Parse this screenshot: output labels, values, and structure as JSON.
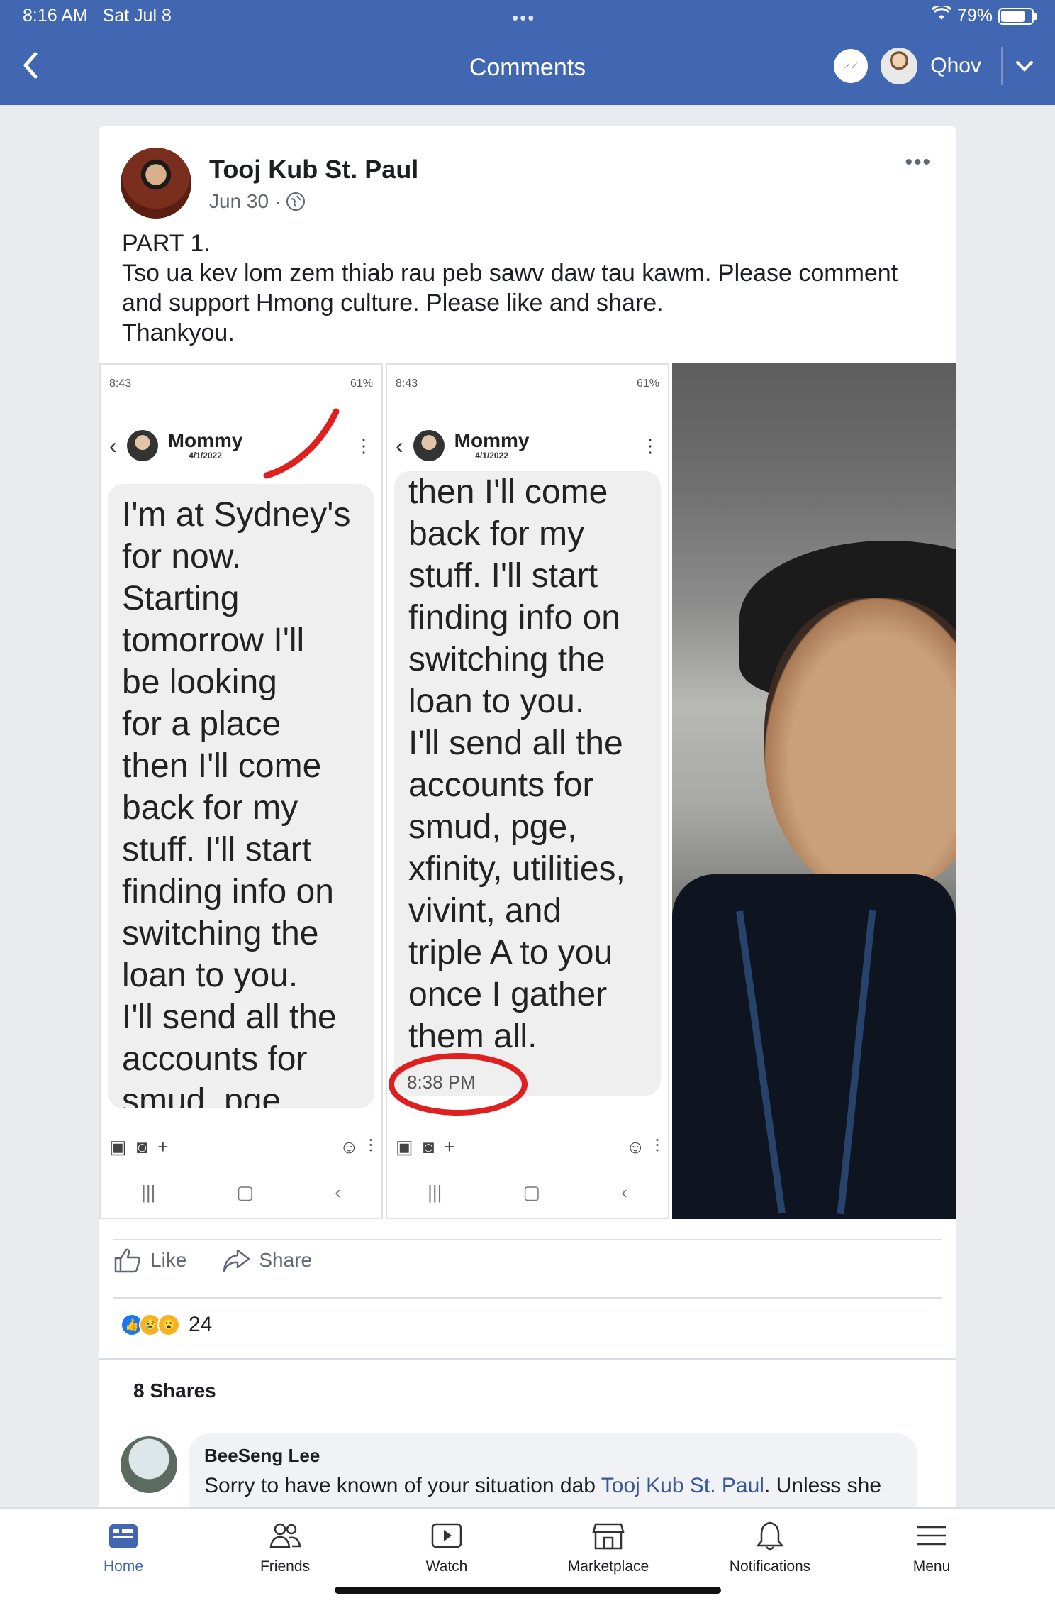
{
  "status_bar": {
    "time": "8:16 AM",
    "date": "Sat Jul 8",
    "battery": "79%",
    "battery_level": 0.79
  },
  "nav": {
    "title": "Comments",
    "user": "Qhov"
  },
  "post": {
    "author": "Tooj Kub St. Paul",
    "date": "Jun 30",
    "separator": "·",
    "text": "PART 1.\nTso ua kev lom zem thiab rau peb sawv daw tau kawm. Please comment and support Hmong culture.  Please like and share.\nThankyou."
  },
  "screenshot1": {
    "time": "8:43",
    "battery": "61%",
    "contact": "Mommy",
    "date": "4/1/2022",
    "message": "I'm at Sydney's\nfor now.\nStarting\ntomorrow I'll\nbe looking\nfor a place\nthen I'll come\nback for my\nstuff. I'll start\nfinding info on\nswitching the\nloan to you.\nI'll send all the\naccounts for\nsmud, pge,"
  },
  "screenshot2": {
    "time": "8:43",
    "battery": "61%",
    "contact": "Mommy",
    "date": "4/1/2022",
    "message": "then I'll come\nback for my\nstuff. I'll start\nfinding info on\nswitching the\nloan to you.\nI'll send all the\naccounts for\nsmud, pge,\nxfinity,  utilities,\nvivint, and\ntriple A to you\nonce I gather\nthem all.",
    "sent_time": "8:38 PM"
  },
  "actions": {
    "like": "Like",
    "share": "Share"
  },
  "reactions": {
    "count": "24"
  },
  "shares": "8 Shares",
  "comment": {
    "author": "BeeSeng Lee",
    "text_before": "Sorry to have known of your situation dab ",
    "mention": "Tooj Kub St. Paul",
    "text_after": ".  Unless she"
  },
  "tabbar": {
    "home": "Home",
    "friends": "Friends",
    "watch": "Watch",
    "marketplace": "Marketplace",
    "notifications": "Notifications",
    "menu": "Menu"
  },
  "colors": {
    "brand": "#4267b2",
    "link": "#385898",
    "like": "#1877f2",
    "red_ink": "#e0201e"
  }
}
